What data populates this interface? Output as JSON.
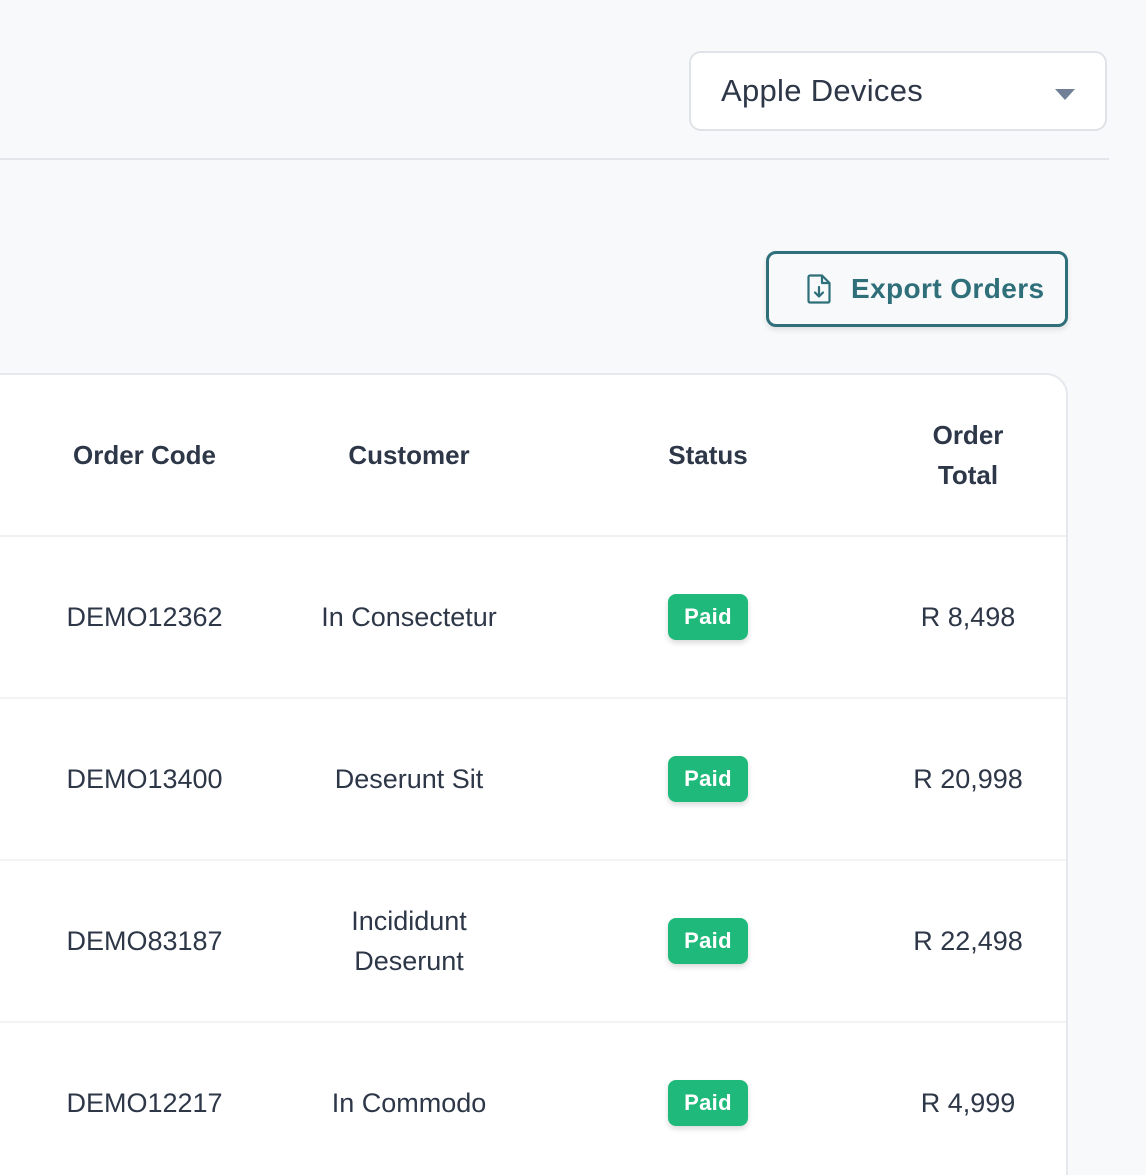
{
  "store_selector": {
    "selected": "Apple Devices",
    "icon": "caret-down-icon"
  },
  "toolbar": {
    "export_label": "Export Orders",
    "export_icon": "file-download-icon",
    "accent_color": "#2f6f7a"
  },
  "table": {
    "headers": {
      "order_code": "Order Code",
      "customer": "Customer",
      "status": "Status",
      "order_total_line1": "Order",
      "order_total_line2": "Total"
    },
    "rows": [
      {
        "order_code": "DEMO12362",
        "customer": "In Consectetur",
        "status": "Paid",
        "total": "R 8,498"
      },
      {
        "order_code": "DEMO13400",
        "customer": "Deserunt Sit",
        "status": "Paid",
        "total": "R 20,998"
      },
      {
        "order_code": "DEMO83187",
        "customer_line1": "Incididunt",
        "customer_line2": "Deserunt",
        "status": "Paid",
        "total": "R 22,498"
      },
      {
        "order_code": "DEMO12217",
        "customer": "In Commodo",
        "status": "Paid",
        "total": "R 4,999"
      }
    ],
    "status_color": "#1fba7b"
  }
}
